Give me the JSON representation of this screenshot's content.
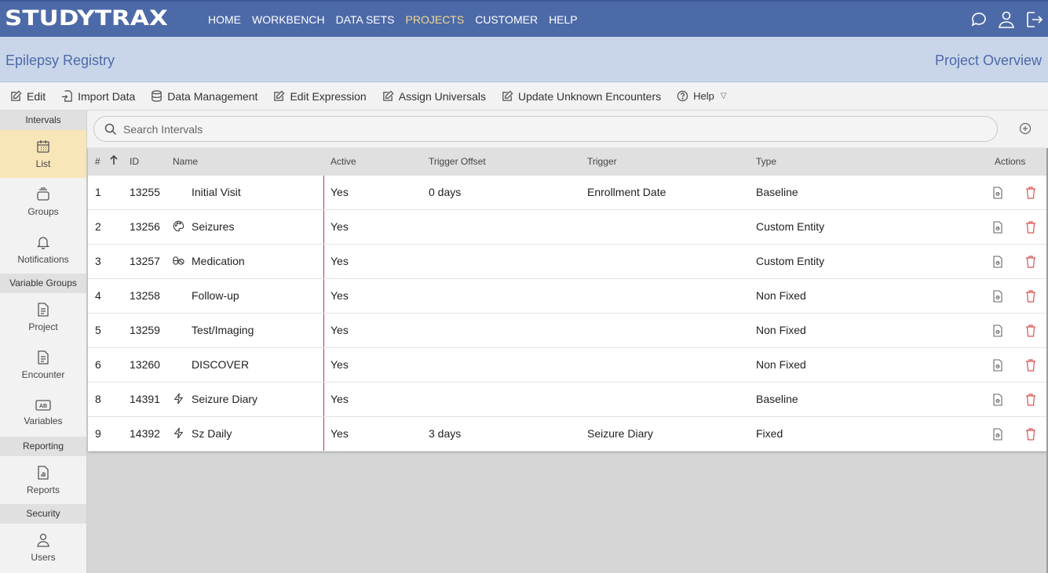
{
  "app": {
    "logo": "STUDYTRAX",
    "nav": [
      "HOME",
      "WORKBENCH",
      "DATA SETS",
      "PROJECTS",
      "CUSTOMER",
      "HELP"
    ],
    "active_nav": "PROJECTS"
  },
  "project": {
    "title": "Epilepsy Registry",
    "view": "Project Overview"
  },
  "toolbar": {
    "edit": "Edit",
    "import": "Import Data",
    "data_mgmt": "Data Management",
    "edit_expr": "Edit Expression",
    "assign": "Assign Universals",
    "update": "Update Unknown Encounters",
    "help": "Help"
  },
  "sidebar": {
    "sections": {
      "intervals": "Intervals",
      "variable_groups": "Variable Groups",
      "reporting": "Reporting",
      "security": "Security"
    },
    "items": {
      "list": "List",
      "groups": "Groups",
      "notifications": "Notifications",
      "project": "Project",
      "encounter": "Encounter",
      "variables": "Variables",
      "reports": "Reports",
      "users": "Users"
    }
  },
  "search": {
    "placeholder": "Search Intervals"
  },
  "table": {
    "headers": {
      "num": "#",
      "id": "ID",
      "name": "Name",
      "active": "Active",
      "offset": "Trigger Offset",
      "trigger": "Trigger",
      "type": "Type",
      "actions": "Actions"
    },
    "rows": [
      {
        "num": "1",
        "id": "13255",
        "icon": "",
        "name": "Initial Visit",
        "active": "Yes",
        "offset": "0 days",
        "trigger": "Enrollment Date",
        "type": "Baseline"
      },
      {
        "num": "2",
        "id": "13256",
        "icon": "palette-icon",
        "name": "Seizures",
        "active": "Yes",
        "offset": "",
        "trigger": "",
        "type": "Custom Entity"
      },
      {
        "num": "3",
        "id": "13257",
        "icon": "pills-icon",
        "name": "Medication",
        "active": "Yes",
        "offset": "",
        "trigger": "",
        "type": "Custom Entity"
      },
      {
        "num": "4",
        "id": "13258",
        "icon": "",
        "name": "Follow-up",
        "active": "Yes",
        "offset": "",
        "trigger": "",
        "type": "Non Fixed"
      },
      {
        "num": "5",
        "id": "13259",
        "icon": "",
        "name": "Test/Imaging",
        "active": "Yes",
        "offset": "",
        "trigger": "",
        "type": "Non Fixed"
      },
      {
        "num": "6",
        "id": "13260",
        "icon": "",
        "name": "DISCOVER",
        "active": "Yes",
        "offset": "",
        "trigger": "",
        "type": "Non Fixed"
      },
      {
        "num": "8",
        "id": "14391",
        "icon": "bolt-icon",
        "name": "Seizure Diary",
        "active": "Yes",
        "offset": "",
        "trigger": "",
        "type": "Baseline"
      },
      {
        "num": "9",
        "id": "14392",
        "icon": "bolt-icon",
        "name": "Sz Daily",
        "active": "Yes",
        "offset": "3 days",
        "trigger": "Seizure Diary",
        "type": "Fixed"
      }
    ]
  },
  "colors": {
    "nav_bg": "#4d6aa8",
    "band_bg": "#c9d6ea",
    "active_nav": "#f4d890",
    "sidebar_active": "#f8e5b8",
    "delete": "#d9534f"
  }
}
